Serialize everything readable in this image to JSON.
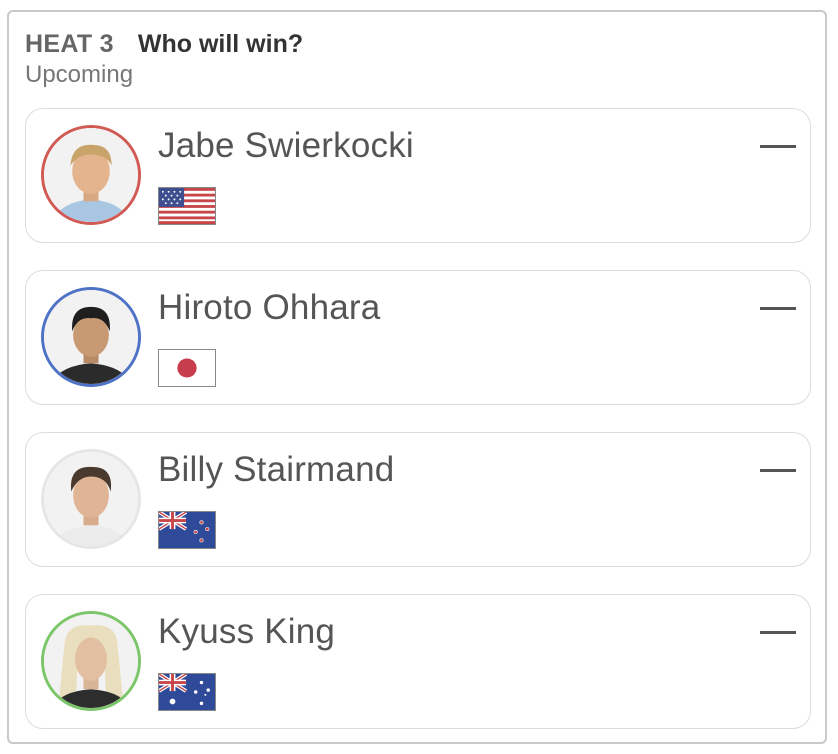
{
  "heat": {
    "label": "HEAT 3",
    "question": "Who will win?",
    "status": "Upcoming"
  },
  "surfers": [
    {
      "name": "Jabe Swierkocki",
      "ring_color": "#d15a55",
      "flag": "us-flag-icon",
      "pick": "—"
    },
    {
      "name": "Hiroto Ohhara",
      "ring_color": "#4e72c6",
      "flag": "japan-flag-icon",
      "pick": "—"
    },
    {
      "name": "Billy Stairmand",
      "ring_color": "#e6e6e6",
      "flag": "new-zealand-flag-icon",
      "pick": "—"
    },
    {
      "name": "Kyuss King",
      "ring_color": "#7cc66a",
      "flag": "australia-flag-icon",
      "pick": "—"
    }
  ]
}
